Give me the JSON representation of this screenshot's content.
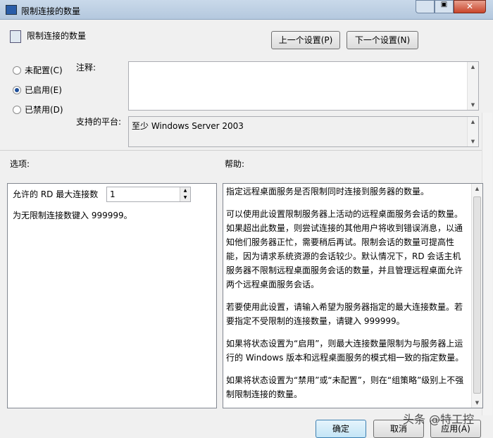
{
  "window": {
    "title": "限制连接的数量"
  },
  "header": {
    "title": "限制连接的数量",
    "prev_button": "上一个设置(P)",
    "next_button": "下一个设置(N)"
  },
  "state": {
    "options": [
      {
        "label": "未配置(C)",
        "selected": false
      },
      {
        "label": "已启用(E)",
        "selected": true
      },
      {
        "label": "已禁用(D)",
        "selected": false
      }
    ]
  },
  "comment": {
    "label": "注释:",
    "value": ""
  },
  "platform": {
    "label": "支持的平台:",
    "value": "至少 Windows Server 2003"
  },
  "options": {
    "label": "选项:",
    "max_label": "允许的 RD 最大连接数",
    "max_value": "1",
    "hint": "为无限制连接数键入 999999。"
  },
  "help": {
    "label": "帮助:",
    "paragraphs": [
      "指定远程桌面服务是否限制同时连接到服务器的数量。",
      "可以使用此设置限制服务器上活动的远程桌面服务会话的数量。如果超出此数量，则尝试连接的其他用户将收到错误消息，以通知他们服务器正忙，需要稍后再试。限制会话的数量可提高性能，因为请求系统资源的会话较少。默认情况下，RD 会话主机服务器不限制远程桌面服务会话的数量，并且管理远程桌面允许两个远程桌面服务会话。",
      "若要使用此设置，请输入希望为服务器指定的最大连接数量。若要指定不受限制的连接数量，请键入 999999。",
      "如果将状态设置为“启用”，则最大连接数量限制为与服务器上运行的 Windows 版本和远程桌面服务的模式相一致的指定数量。",
      "如果将状态设置为“禁用”或“未配置”，则在“组策略”级别上不强制限制连接的数量。"
    ]
  },
  "footer": {
    "ok": "确定",
    "cancel": "取消",
    "apply": "应用(A)"
  },
  "watermark": "头条 @特工控"
}
